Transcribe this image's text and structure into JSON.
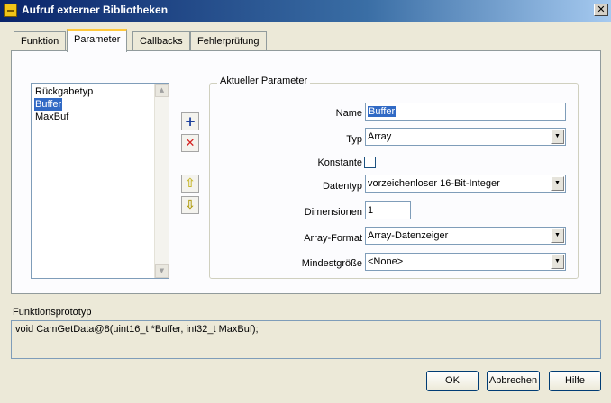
{
  "window": {
    "title": "Aufruf externer Bibliotheken",
    "close_glyph": "✕",
    "icon": "app-icon"
  },
  "tabs": [
    {
      "label": "Funktion",
      "active": false
    },
    {
      "label": "Parameter",
      "active": true
    },
    {
      "label": "Callbacks",
      "active": false
    },
    {
      "label": "Fehlerprüfung",
      "active": false
    }
  ],
  "param_list": {
    "items": [
      "Rückgabetyp",
      "Buffer",
      "MaxBuf"
    ],
    "selected_index": 1
  },
  "side_buttons": {
    "add_glyph": "+",
    "delete_glyph": "✕",
    "up_glyph": "⇧",
    "down_glyph": "⇩"
  },
  "current_param": {
    "group_title": "Aktueller Parameter",
    "name_label": "Name",
    "name_value": "Buffer",
    "type_label": "Typ",
    "type_value": "Array",
    "const_label": "Konstante",
    "const_checked": false,
    "datatype_label": "Datentyp",
    "datatype_value": "vorzeichenloser 16-Bit-Integer",
    "dims_label": "Dimensionen",
    "dims_value": "1",
    "arrayformat_label": "Array-Format",
    "arrayformat_value": "Array-Datenzeiger",
    "minsize_label": "Mindestgröße",
    "minsize_value": "<None>"
  },
  "prototype": {
    "label": "Funktionsprototyp",
    "text": "void  CamGetData@8(uint16_t *Buffer, int32_t MaxBuf);"
  },
  "buttons": {
    "ok": "OK",
    "cancel": "Abbrechen",
    "help": "Hilfe"
  },
  "colors": {
    "titlebar_start": "#0a246a",
    "selection": "#316ac5",
    "dialog_bg": "#ece9d8",
    "add_icon": "#1c3f9c",
    "delete_icon": "#d42020",
    "arrow_icon": "#e8d830"
  }
}
